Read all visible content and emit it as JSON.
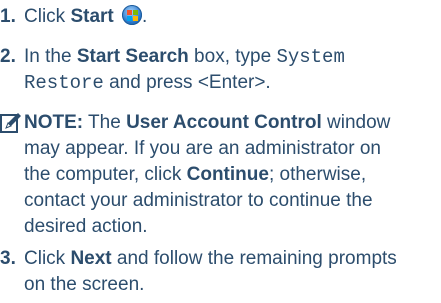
{
  "step1": {
    "number": "1.",
    "text_before": "Click ",
    "start_label": "Start",
    "text_after": "."
  },
  "step2": {
    "number": "2.",
    "text_1": "In the ",
    "field_label": "Start Search",
    "text_2": " box, type ",
    "mono_1": "System",
    "mono_2": "Restore",
    "text_3": " and press <Enter>."
  },
  "note": {
    "label": "NOTE:",
    "text_1": " The ",
    "uac_label": "User Account Control",
    "text_2": " window",
    "line2": "may appear. If you are an administrator on",
    "text_3": "the computer, click ",
    "continue_label": "Continue",
    "text_4": "; otherwise,",
    "line4": "contact your administrator to continue the",
    "line5": "desired action."
  },
  "step3": {
    "number": "3.",
    "text_1": "Click ",
    "next_label": "Next",
    "text_2": " and follow the remaining prompts",
    "line2": "on the screen."
  },
  "colors": {
    "text": "#2c4d6d"
  }
}
